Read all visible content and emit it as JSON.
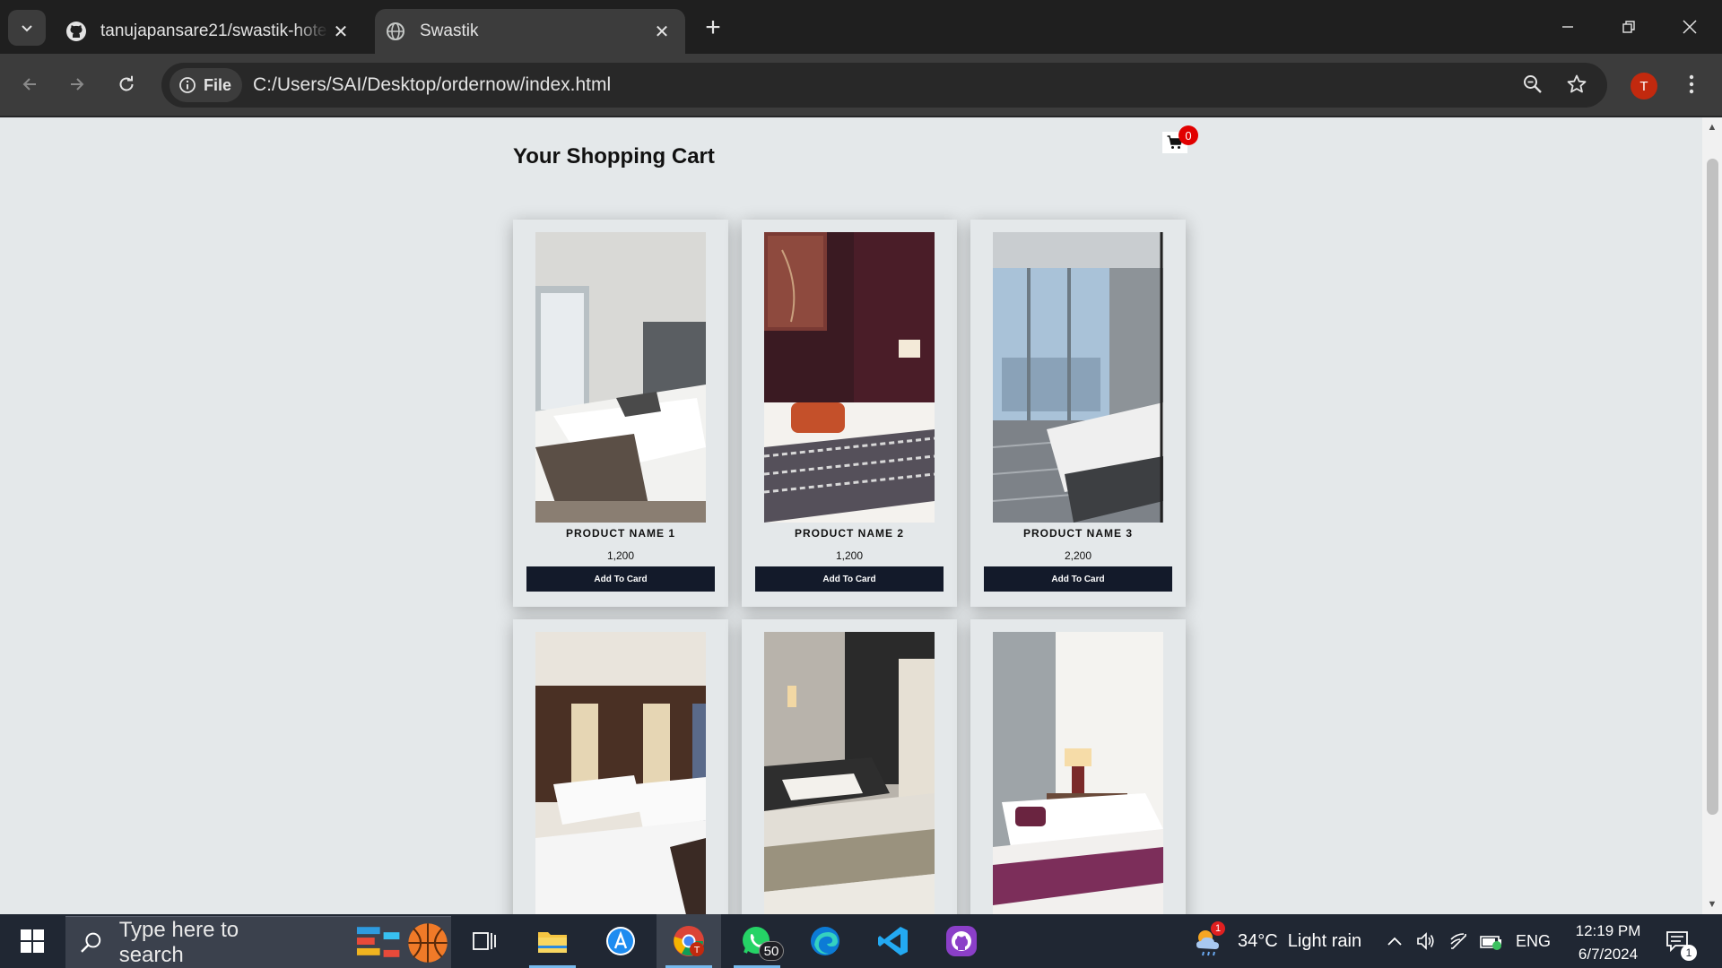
{
  "browser": {
    "tabs": [
      {
        "title": "tanujapansare21/swastik-hotel-",
        "icon": "github-icon",
        "active": false
      },
      {
        "title": "Swastik",
        "icon": "globe-icon",
        "active": true
      }
    ],
    "chip_label": "File",
    "url": "C:/Users/SAI/Desktop/ordernow/index.html",
    "profile_initial": "T"
  },
  "page": {
    "title": "Your Shopping Cart",
    "cart_count": "0",
    "products": [
      {
        "name": "PRODUCT NAME 1",
        "price": "1,200",
        "button": "Add To Card"
      },
      {
        "name": "PRODUCT NAME 2",
        "price": "1,200",
        "button": "Add To Card"
      },
      {
        "name": "PRODUCT NAME 3",
        "price": "2,200",
        "button": "Add To Card"
      },
      {
        "name": "",
        "price": "",
        "button": ""
      },
      {
        "name": "",
        "price": "",
        "button": ""
      },
      {
        "name": "",
        "price": "",
        "button": ""
      }
    ]
  },
  "taskbar": {
    "search_placeholder": "Type here to search",
    "whatsapp_badge": "50",
    "weather_badge": "1",
    "weather": "34°C  Light rain",
    "language": "ENG",
    "time": "12:19 PM",
    "date": "6/7/2024",
    "notification_count": "1"
  },
  "colors": {
    "page_background": "#e4e8ea",
    "button": "#131a2a",
    "cart_badge": "#e10000",
    "profile": "#c2290e"
  }
}
